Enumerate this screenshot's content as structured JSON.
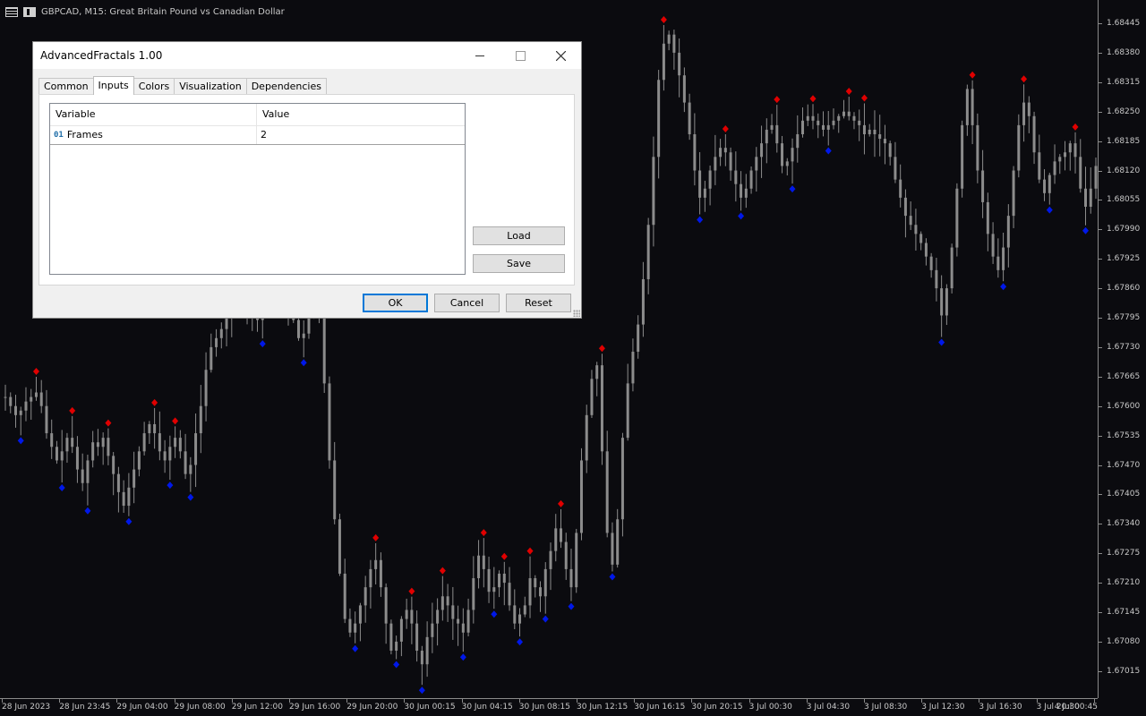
{
  "chart": {
    "symbol_title": "GBPCAD, M15:  Great Britain Pound vs Canadian Dollar",
    "price_labels": [
      "1.68445",
      "1.68380",
      "1.68315",
      "1.68250",
      "1.68185",
      "1.68120",
      "1.68055",
      "1.67990",
      "1.67925",
      "1.67860",
      "1.67795",
      "1.67730",
      "1.67665",
      "1.67600",
      "1.67535",
      "1.67470",
      "1.67405",
      "1.67340",
      "1.67275",
      "1.67210",
      "1.67145",
      "1.67080",
      "1.67015"
    ],
    "time_labels": [
      "28 Jun 2023",
      "28 Jun 23:45",
      "29 Jun 04:00",
      "29 Jun 08:00",
      "29 Jun 12:00",
      "29 Jun 16:00",
      "29 Jun 20:00",
      "30 Jun 00:15",
      "30 Jun 04:15",
      "30 Jun 08:15",
      "30 Jun 12:15",
      "30 Jun 16:15",
      "30 Jun 20:15",
      "3 Jul 00:30",
      "3 Jul 04:30",
      "3 Jul 08:30",
      "3 Jul 12:30",
      "3 Jul 16:30",
      "3 Jul 20:30",
      "4 Jul 00:45"
    ],
    "colors": {
      "background": "#0b0b0f",
      "candle": "#8c8c8c",
      "fractal_up": "#e00000",
      "fractal_down": "#0018e8",
      "axis_text": "#c8c8c8"
    },
    "series_close": [
      1.6762,
      1.676,
      1.6758,
      1.6759,
      1.6761,
      1.6762,
      1.6763,
      1.676,
      1.6754,
      1.6751,
      1.6748,
      1.675,
      1.6753,
      1.6751,
      1.6746,
      1.6743,
      1.6748,
      1.6752,
      1.6751,
      1.6753,
      1.6749,
      1.6745,
      1.6741,
      1.6738,
      1.6742,
      1.6746,
      1.675,
      1.6754,
      1.6756,
      1.6754,
      1.675,
      1.6748,
      1.6751,
      1.6753,
      1.675,
      1.6745,
      1.6747,
      1.6754,
      1.676,
      1.6768,
      1.6773,
      1.6775,
      1.6777,
      1.678,
      1.6784,
      1.6786,
      1.6785,
      1.6783,
      1.6781,
      1.6779,
      1.6782,
      1.6785,
      1.6786,
      1.6788,
      1.6786,
      1.6782,
      1.6779,
      1.6775,
      1.6776,
      1.678,
      1.6783,
      1.6781,
      1.6765,
      1.6748,
      1.6735,
      1.6723,
      1.6713,
      1.671,
      1.6712,
      1.6716,
      1.672,
      1.6724,
      1.6726,
      1.672,
      1.6712,
      1.6706,
      1.6708,
      1.6713,
      1.6715,
      1.6712,
      1.6706,
      1.6703,
      1.6709,
      1.6712,
      1.6715,
      1.6718,
      1.6716,
      1.6713,
      1.6712,
      1.671,
      1.6715,
      1.6722,
      1.6727,
      1.6724,
      1.6719,
      1.672,
      1.6723,
      1.6721,
      1.6716,
      1.6712,
      1.6714,
      1.6716,
      1.6722,
      1.672,
      1.6718,
      1.6724,
      1.6728,
      1.6733,
      1.673,
      1.6724,
      1.672,
      1.6732,
      1.6748,
      1.6758,
      1.6766,
      1.6769,
      1.675,
      1.6732,
      1.6725,
      1.6735,
      1.6753,
      1.6765,
      1.6772,
      1.6778,
      1.6788,
      1.68,
      1.6815,
      1.6832,
      1.684,
      1.6842,
      1.6838,
      1.6833,
      1.6827,
      1.682,
      1.6812,
      1.6806,
      1.6808,
      1.6812,
      1.6815,
      1.6817,
      1.6816,
      1.6812,
      1.6809,
      1.6806,
      1.6808,
      1.6812,
      1.6815,
      1.6818,
      1.6821,
      1.6822,
      1.6818,
      1.6813,
      1.6814,
      1.6817,
      1.682,
      1.6823,
      1.6824,
      1.6823,
      1.6822,
      1.6821,
      1.6822,
      1.6823,
      1.6824,
      1.6825,
      1.6824,
      1.6823,
      1.6822,
      1.682,
      1.6821,
      1.682,
      1.6819,
      1.6818,
      1.6815,
      1.681,
      1.6806,
      1.6802,
      1.68,
      1.6798,
      1.6796,
      1.6793,
      1.679,
      1.6786,
      1.678,
      1.6786,
      1.6795,
      1.6808,
      1.6822,
      1.683,
      1.6822,
      1.6812,
      1.6805,
      1.6798,
      1.6793,
      1.679,
      1.6795,
      1.6802,
      1.6812,
      1.6822,
      1.6827,
      1.6824,
      1.6816,
      1.681,
      1.6807,
      1.6811,
      1.6814,
      1.6815,
      1.6816,
      1.6818,
      1.6815,
      1.6808,
      1.6804,
      1.6808,
      1.6813
    ]
  },
  "dialog": {
    "title": "AdvancedFractals 1.00",
    "tabs": [
      "Common",
      "Inputs",
      "Colors",
      "Visualization",
      "Dependencies"
    ],
    "grid": {
      "headers": [
        "Variable",
        "Value"
      ],
      "rows": [
        {
          "icon": "01",
          "variable": "Frames",
          "value": "2"
        }
      ]
    },
    "load_label": "Load",
    "save_label": "Save",
    "ok_label": "OK",
    "cancel_label": "Cancel",
    "reset_label": "Reset"
  }
}
